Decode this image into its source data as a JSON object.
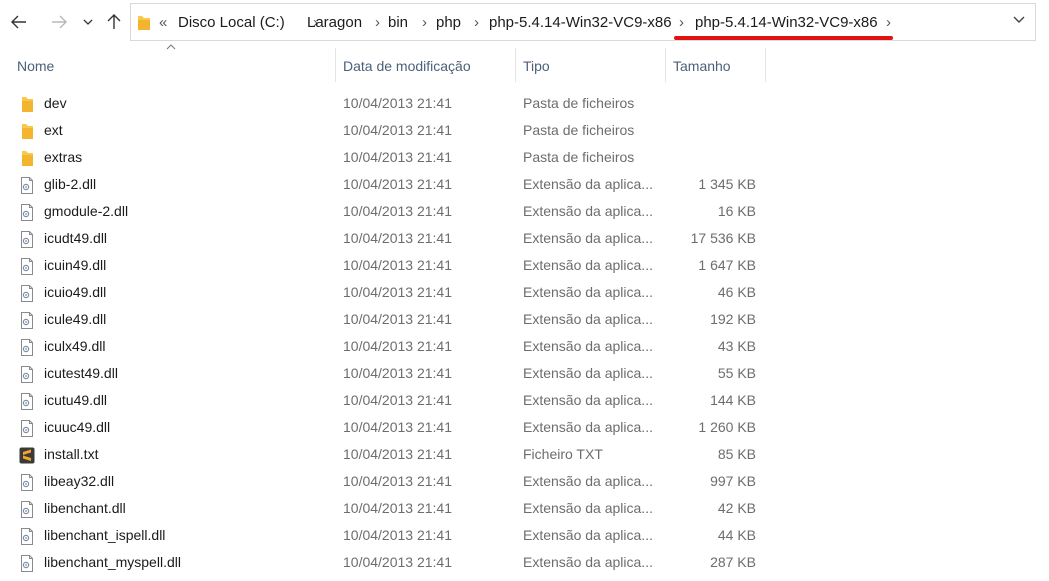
{
  "breadcrumb": {
    "overflow": "«",
    "items": [
      "Disco Local (C:)",
      "Laragon",
      "bin",
      "php",
      "php-5.4.14-Win32-VC9-x86",
      "php-5.4.14-Win32-VC9-x86"
    ]
  },
  "columns": {
    "name": "Nome",
    "date": "Data de modificação",
    "type": "Tipo",
    "size": "Tamanho"
  },
  "files": [
    {
      "name": "dev",
      "date": "10/04/2013 21:41",
      "type": "Pasta de ficheiros",
      "size": "",
      "icon": "folder-icon"
    },
    {
      "name": "ext",
      "date": "10/04/2013 21:41",
      "type": "Pasta de ficheiros",
      "size": "",
      "icon": "folder-icon"
    },
    {
      "name": "extras",
      "date": "10/04/2013 21:41",
      "type": "Pasta de ficheiros",
      "size": "",
      "icon": "folder-icon"
    },
    {
      "name": "glib-2.dll",
      "date": "10/04/2013 21:41",
      "type": "Extensão da aplica...",
      "size": "1 345 KB",
      "icon": "dll-file-icon"
    },
    {
      "name": "gmodule-2.dll",
      "date": "10/04/2013 21:41",
      "type": "Extensão da aplica...",
      "size": "16 KB",
      "icon": "dll-file-icon"
    },
    {
      "name": "icudt49.dll",
      "date": "10/04/2013 21:41",
      "type": "Extensão da aplica...",
      "size": "17 536 KB",
      "icon": "dll-file-icon"
    },
    {
      "name": "icuin49.dll",
      "date": "10/04/2013 21:41",
      "type": "Extensão da aplica...",
      "size": "1 647 KB",
      "icon": "dll-file-icon"
    },
    {
      "name": "icuio49.dll",
      "date": "10/04/2013 21:41",
      "type": "Extensão da aplica...",
      "size": "46 KB",
      "icon": "dll-file-icon"
    },
    {
      "name": "icule49.dll",
      "date": "10/04/2013 21:41",
      "type": "Extensão da aplica...",
      "size": "192 KB",
      "icon": "dll-file-icon"
    },
    {
      "name": "iculx49.dll",
      "date": "10/04/2013 21:41",
      "type": "Extensão da aplica...",
      "size": "43 KB",
      "icon": "dll-file-icon"
    },
    {
      "name": "icutest49.dll",
      "date": "10/04/2013 21:41",
      "type": "Extensão da aplica...",
      "size": "55 KB",
      "icon": "dll-file-icon"
    },
    {
      "name": "icutu49.dll",
      "date": "10/04/2013 21:41",
      "type": "Extensão da aplica...",
      "size": "144 KB",
      "icon": "dll-file-icon"
    },
    {
      "name": "icuuc49.dll",
      "date": "10/04/2013 21:41",
      "type": "Extensão da aplica...",
      "size": "1 260 KB",
      "icon": "dll-file-icon"
    },
    {
      "name": "install.txt",
      "date": "10/04/2013 21:41",
      "type": "Ficheiro TXT",
      "size": "85 KB",
      "icon": "sublime-text-file-icon"
    },
    {
      "name": "libeay32.dll",
      "date": "10/04/2013 21:41",
      "type": "Extensão da aplica...",
      "size": "997 KB",
      "icon": "dll-file-icon"
    },
    {
      "name": "libenchant.dll",
      "date": "10/04/2013 21:41",
      "type": "Extensão da aplica...",
      "size": "42 KB",
      "icon": "dll-file-icon"
    },
    {
      "name": "libenchant_ispell.dll",
      "date": "10/04/2013 21:41",
      "type": "Extensão da aplica...",
      "size": "44 KB",
      "icon": "dll-file-icon"
    },
    {
      "name": "libenchant_myspell.dll",
      "date": "10/04/2013 21:41",
      "type": "Extensão da aplica...",
      "size": "287 KB",
      "icon": "dll-file-icon"
    }
  ],
  "colors": {
    "highlight_underline": "#e01212",
    "folder": "#f8c94b",
    "header_text": "#4c607a"
  }
}
